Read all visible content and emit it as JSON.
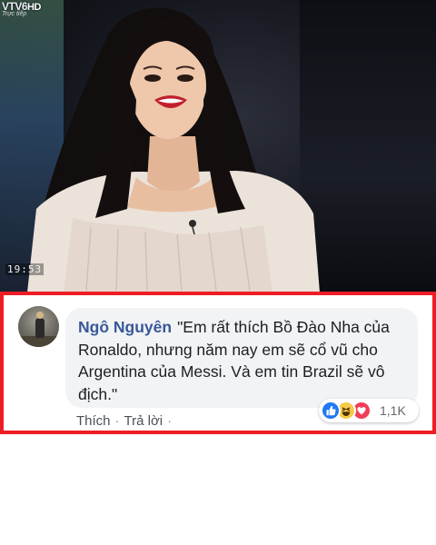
{
  "video": {
    "channel_logo": "VTV6",
    "channel_hd": "HD",
    "channel_sub": "Trực tiếp",
    "timestamp": "19:53"
  },
  "comment": {
    "author": "Ngô Nguyên",
    "text": "\"Em rất thích Bồ Đào Nha của Ronaldo, nhưng năm nay em sẽ cổ vũ cho Argentina của Messi. Và em tin Brazil sẽ vô địch.\"",
    "reactions": {
      "icons": [
        "like-icon",
        "haha-icon",
        "love-icon"
      ],
      "count": "1,1K"
    },
    "actions": {
      "like": "Thích",
      "reply": "Trả lời",
      "separator": "·"
    }
  },
  "colors": {
    "frame_border": "#ee1c25",
    "author_link": "#385898",
    "bubble_bg": "#f2f3f5",
    "like_blue": "#2078f4",
    "haha_yellow": "#f7c948",
    "love_red": "#f33e58"
  }
}
